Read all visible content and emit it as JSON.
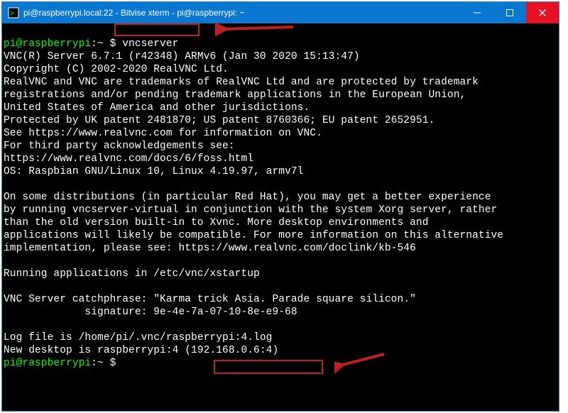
{
  "window": {
    "title": "pi@raspberrypi.local:22 - Bitvise xterm - pi@raspberrypi: ~"
  },
  "prompt": {
    "user_host": "pi@raspberrypi",
    "cwd_symbol": ":~ $ ",
    "command": "vncserver"
  },
  "output": {
    "l1": "VNC(R) Server 6.7.1 (r42348) ARMv6 (Jan 30 2020 15:13:47)",
    "l2": "Copyright (C) 2002-2020 RealVNC Ltd.",
    "l3": "RealVNC and VNC are trademarks of RealVNC Ltd and are protected by trademark",
    "l4": "registrations and/or pending trademark applications in the European Union,",
    "l5": "United States of America and other jurisdictions.",
    "l6": "Protected by UK patent 2481870; US patent 8760366; EU patent 2652951.",
    "l7": "See https://www.realvnc.com for information on VNC.",
    "l8": "For third party acknowledgements see:",
    "l9": "https://www.realvnc.com/docs/6/foss.html",
    "l10": "OS: Raspbian GNU/Linux 10, Linux 4.19.97, armv7l",
    "l11": "On some distributions (in particular Red Hat), you may get a better experience",
    "l12": "by running vncserver-virtual in conjunction with the system Xorg server, rather",
    "l13": "than the old version built-in to Xvnc. More desktop environments and",
    "l14": "applications will likely be compatible. For more information on this alternative",
    "l15": "implementation, please see: https://www.realvnc.com/doclink/kb-546",
    "l16": "Running applications in /etc/vnc/xstartup",
    "l17": "VNC Server catchphrase: \"Karma trick Asia. Parade square silicon.\"",
    "l18": "             signature: 9e-4e-7a-07-10-8e-e9-68",
    "l19": "Log file is /home/pi/.vnc/raspberrypi:4.log",
    "l20": "New desktop is raspberrypi:4 (192.168.0.6:4)"
  },
  "prompt2": {
    "user_host": "pi@raspberrypi",
    "cwd_symbol": ":~ $ "
  },
  "annotations": {
    "highlight1": "vncserver command highlighted",
    "highlight2": "(192.168.0.6:4) highlighted"
  },
  "colors": {
    "titlebar": "#0a78d0",
    "close": "#e81123",
    "prompt_green": "#00ff00",
    "anno_red": "#c22020"
  }
}
